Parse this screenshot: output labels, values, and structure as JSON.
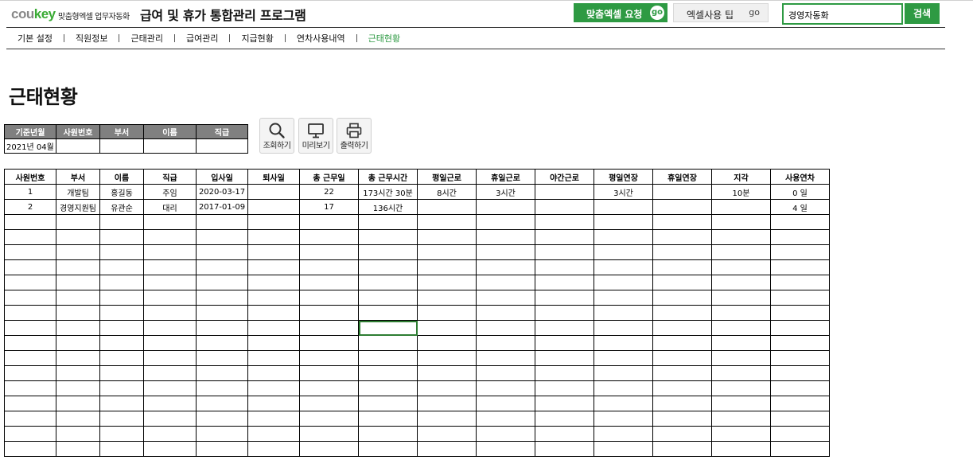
{
  "header": {
    "logo_part1": "cou",
    "logo_part2": "key",
    "tagline": "맞춤형엑셀 업무자동화",
    "app_title": "급여 및 휴가 통합관리 프로그램",
    "custom_request_label": "맞춤엑셀 요청",
    "custom_request_go": "go",
    "tips_label": "엑셀사용 팁",
    "tips_go": "go",
    "search_value": "경영자동화",
    "search_button": "검색"
  },
  "nav": {
    "items": [
      "기본 설정",
      "직원정보",
      "근태관리",
      "급여관리",
      "지급현황",
      "연차사용내역",
      "근태현황"
    ],
    "active_index": 6
  },
  "page_title": "근태현황",
  "filter": {
    "headers": [
      "기준년월",
      "사원번호",
      "부서",
      "이름",
      "직급"
    ],
    "values": [
      "2021년 04월",
      "",
      "",
      "",
      ""
    ]
  },
  "tools": [
    {
      "label": "조회하기",
      "icon": "search-icon"
    },
    {
      "label": "미리보기",
      "icon": "monitor-icon"
    },
    {
      "label": "출력하기",
      "icon": "printer-icon"
    }
  ],
  "table": {
    "headers": [
      "사원번호",
      "부서",
      "이름",
      "직급",
      "입사일",
      "퇴사일",
      "총 근무일",
      "총 근무시간",
      "평일근로",
      "휴일근로",
      "야간근로",
      "평일연장",
      "휴일연장",
      "지각",
      "사용연차"
    ],
    "rows": [
      [
        "1",
        "개발팀",
        "홍길동",
        "주임",
        "2020-03-17",
        "",
        "22",
        "173시간 30분",
        "8시간",
        "3시간",
        "",
        "3시간",
        "",
        "10분",
        "0 일"
      ],
      [
        "2",
        "경영지원팀",
        "유관순",
        "대리",
        "2017-01-09",
        "",
        "17",
        "136시간",
        "",
        "",
        "",
        "",
        "",
        "",
        "4 일"
      ]
    ]
  },
  "colors": {
    "accent": "#2e9a43",
    "header_bg": "#808080"
  }
}
